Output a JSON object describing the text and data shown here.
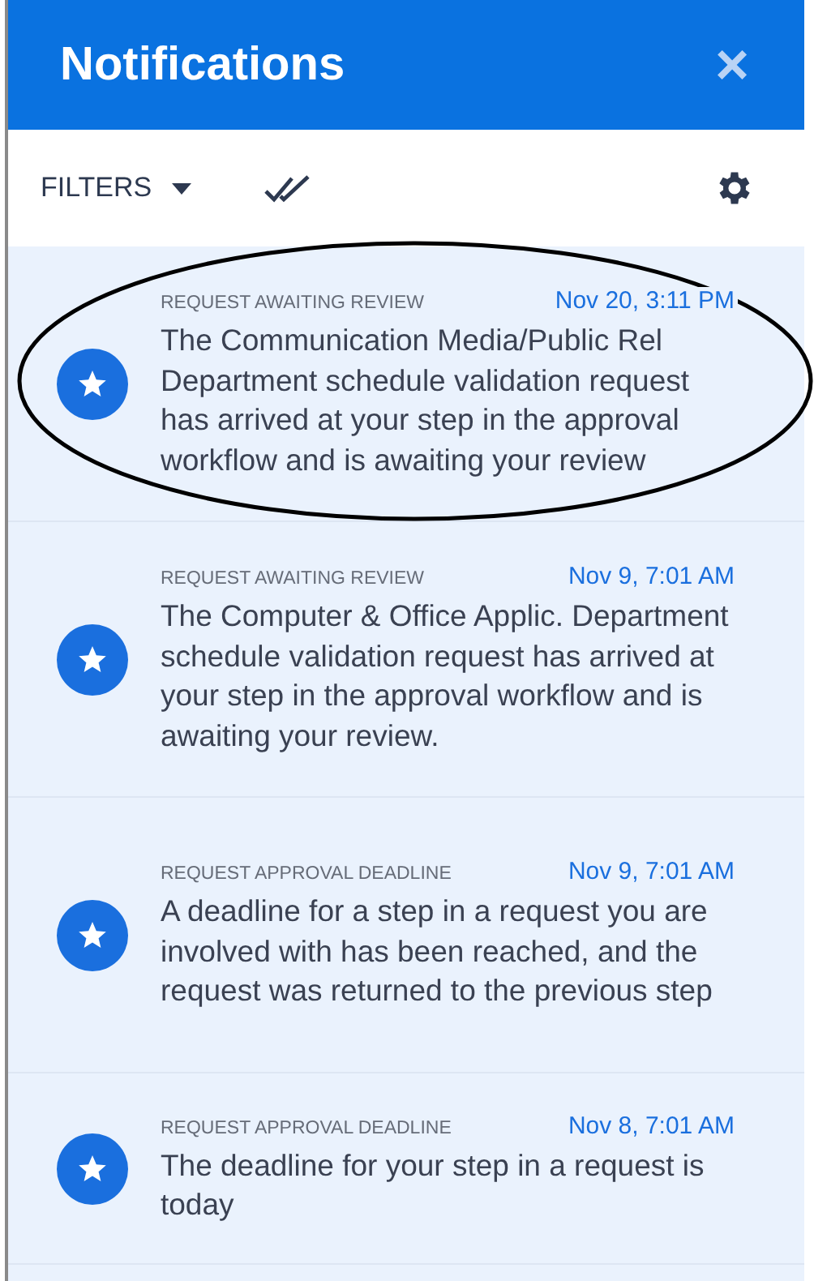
{
  "header": {
    "title": "Notifications",
    "close": "×"
  },
  "toolbar": {
    "filters": "FILTERS"
  },
  "notifications": [
    {
      "category": "REQUEST AWAITING REVIEW",
      "time": "Nov 20, 3:11 PM",
      "text": "The Communication Media/Public Rel Department schedule validation request has arrived at your step in the approval workflow and is awaiting your review",
      "circled": true
    },
    {
      "category": "REQUEST AWAITING REVIEW",
      "time": "Nov 9, 7:01 AM",
      "text": "The Computer & Office Applic. Department schedule validation request has arrived at your step in the approval workflow and is awaiting your review.",
      "circled": false
    },
    {
      "category": "REQUEST APPROVAL DEADLINE",
      "time": "Nov 9, 7:01 AM",
      "text": "A deadline for a step in a request you are involved with has been reached, and the request was returned to the previous step",
      "circled": false
    },
    {
      "category": "REQUEST APPROVAL DEADLINE",
      "time": "Nov 8, 7:01 AM",
      "text": "The deadline for your step in a request is today",
      "circled": false
    }
  ]
}
